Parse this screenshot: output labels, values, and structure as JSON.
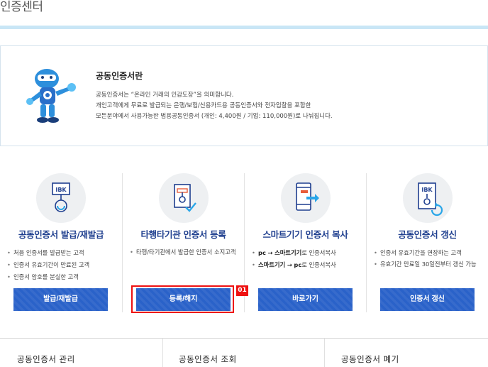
{
  "page": {
    "title": "인증센터"
  },
  "intro": {
    "heading": "공동인증서란",
    "lines": [
      "공동인증서는 “온라인 거래의 인감도장”을 의미합니다.",
      "개인고객에게 무료로 발급되는 은행/보험/신용카드용 공동인증서와 전자입찰을 포함한",
      "모든분야에서 사용가능한 범용공동인증서 (개인: 4,400원 / 기업: 110,000원)로 나눠집니다."
    ]
  },
  "services": [
    {
      "icon": "ibk-certificate-icon",
      "title": "공동인증서 발급/재발급",
      "items": [
        "처음 인증서를 발급받는 고객",
        "인증서 유효기간이 만료된 고객",
        "인증서 암호를 분실한 고객"
      ],
      "button": "발급/재발급"
    },
    {
      "icon": "certificate-check-icon",
      "title": "타행타기관 인증서 등록",
      "items": [
        "타행/타기관에서 발급한 인증서 소지고객"
      ],
      "button": "등록/해지"
    },
    {
      "icon": "smartphone-copy-icon",
      "title": "스마트기기 인증서 복사",
      "items": [
        {
          "from": "pc",
          "arrow": "→",
          "to": "스마트기기",
          "rest": "로 인증서복사"
        },
        {
          "from": "스마트기기",
          "arrow": "→",
          "to": "pc",
          "rest": "로 인증서복사"
        }
      ],
      "button": "바로가기"
    },
    {
      "icon": "certificate-renew-icon",
      "title": "공동인증서 갱신",
      "items": [
        "인증서 유효기간을 연장하는 고객",
        "유효기간 만료일 30일전부터 갱신 가능"
      ],
      "button": "인증서 갱신"
    }
  ],
  "callout": {
    "label": "01"
  },
  "bottom_tabs": [
    "공동인증서 관리",
    "공동인증서 조회",
    "공동인증서 폐기"
  ],
  "colors": {
    "accent": "#2a62c9",
    "title_blue": "#1f3f8f",
    "highlight": "#ee1111",
    "title_bar": "#c9e6f6"
  }
}
